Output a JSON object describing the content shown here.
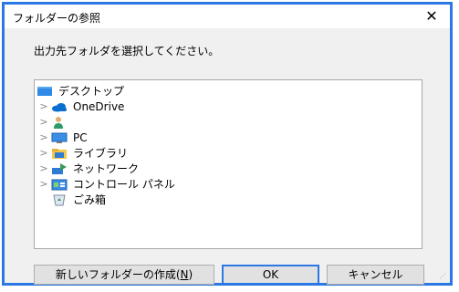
{
  "dialog": {
    "title": "フォルダーの参照",
    "close_label": "✕",
    "instruction": "出力先フォルダを選択してください。"
  },
  "tree": {
    "root": {
      "label": "デスクトップ",
      "icon": "desktop-icon"
    },
    "items": [
      {
        "label": "OneDrive",
        "icon": "onedrive-cloud-icon"
      },
      {
        "label": "",
        "icon": "user-person-icon"
      },
      {
        "label": "PC",
        "icon": "pc-monitor-icon"
      },
      {
        "label": "ライブラリ",
        "icon": "library-folder-icon"
      },
      {
        "label": "ネットワーク",
        "icon": "network-icon"
      },
      {
        "label": "コントロール パネル",
        "icon": "control-panel-icon"
      },
      {
        "label": "ごみ箱",
        "icon": "recycle-bin-icon"
      }
    ],
    "expand_glyph": ">"
  },
  "buttons": {
    "new_folder_label": "新しいフォルダーの作成(",
    "new_folder_key": "N",
    "new_folder_suffix": ")",
    "ok_label": "OK",
    "cancel_label": "キャンセル"
  },
  "colors": {
    "accent": "#2b78e4",
    "dialog_bg": "#f0f0f0",
    "tree_bg": "#ffffff"
  }
}
